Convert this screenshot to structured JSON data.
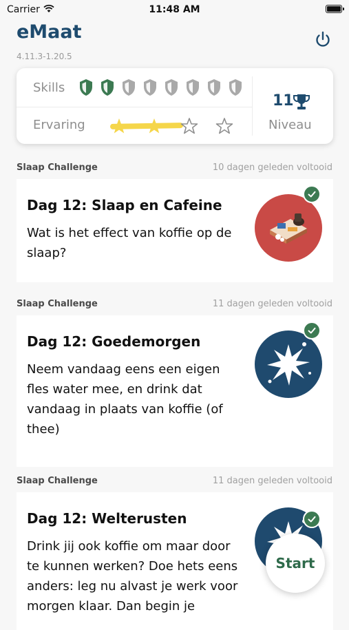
{
  "status_bar": {
    "carrier": "Carrier",
    "time": "11:48 AM"
  },
  "header": {
    "title": "eMaat",
    "version": "4.11.3-1.20.5",
    "power_icon": "power-icon"
  },
  "stats": {
    "skills_label": "Skills",
    "skills_total": 8,
    "skills_earned": 2,
    "ervaring_label": "Ervaring",
    "stars_total": 4,
    "stars_earned": 2,
    "niveau_value": "11",
    "niveau_label": "Niveau",
    "colors": {
      "accent": "#1e4b6e",
      "green": "#3c7a52",
      "inactive": "#a9a9a9",
      "star_highlight": "#f5d64a"
    }
  },
  "challenges": [
    {
      "category": "Slaap Challenge",
      "meta": "10 dagen geleden voltooid",
      "title": "Dag 12: Slaap en Cafeine",
      "text": "Wat is het effect van koffie op de slaap?",
      "image_icon": "coffee-table-icon",
      "completed": true
    },
    {
      "category": "Slaap Challenge",
      "meta": "11 dagen geleden voltooid",
      "title": "Dag 12: Goedemorgen",
      "text": "Neem vandaag eens een eigen fles water mee, en drink dat vandaag in plaats van koffie (of thee)",
      "image_icon": "splash-icon",
      "completed": true
    },
    {
      "category": "Slaap Challenge",
      "meta": "11 dagen geleden voltooid",
      "title": "Dag 12: Welterusten",
      "text": "Drink jij ook koffie om maar door te kunnen werken? Doe hets eens anders: leg nu alvast je werk voor morgen klaar. Dan begin je",
      "image_icon": "splash-icon",
      "completed": true
    }
  ],
  "start_button": {
    "label": "Start"
  }
}
